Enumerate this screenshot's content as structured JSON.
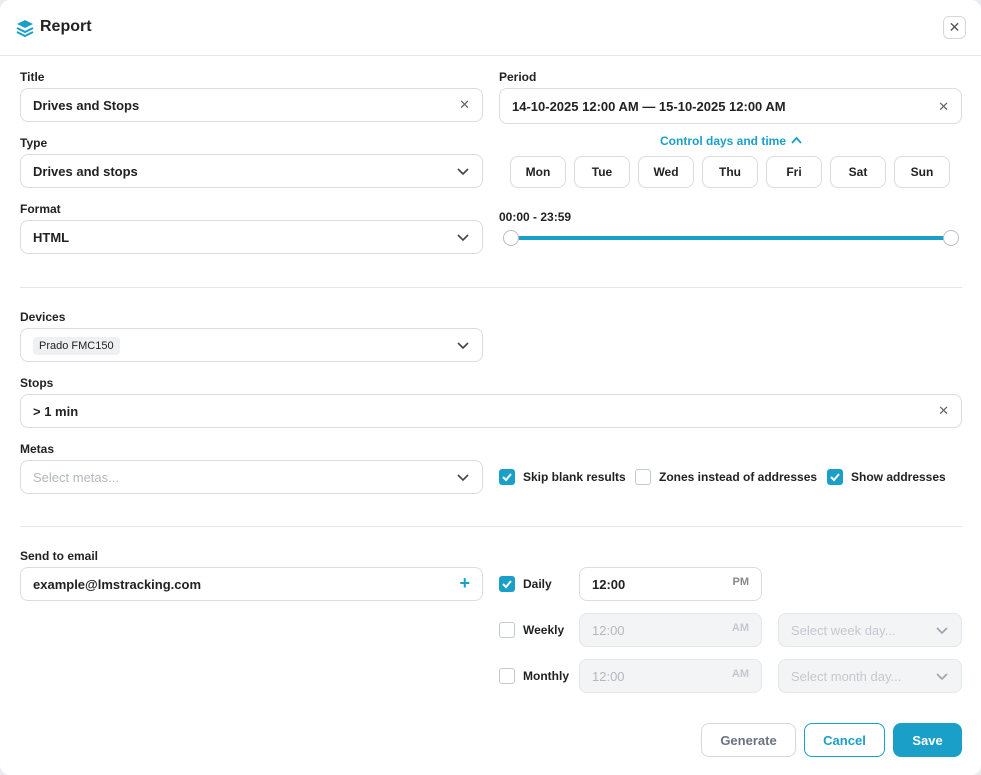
{
  "header": {
    "title": "Report",
    "logo_icon": "layers-icon",
    "close_icon": "close-icon"
  },
  "title_field": {
    "label": "Title",
    "value": "Drives and Stops"
  },
  "period": {
    "label": "Period",
    "value": "14-10-2025 12:00 AM — 15-10-2025 12:00 AM"
  },
  "type_field": {
    "label": "Type",
    "value": "Drives and stops"
  },
  "control_days": {
    "label": "Control days and time",
    "days": [
      "Mon",
      "Tue",
      "Wed",
      "Thu",
      "Fri",
      "Sat",
      "Sun"
    ]
  },
  "format_field": {
    "label": "Format",
    "value": "HTML"
  },
  "time_range": {
    "label": "00:00 - 23:59",
    "start_fraction": 0,
    "end_fraction": 1
  },
  "devices": {
    "label": "Devices",
    "tag": "Prado FMC150"
  },
  "stops": {
    "label": "Stops",
    "value": "> 1 min"
  },
  "metas": {
    "label": "Metas",
    "placeholder": "Select metas..."
  },
  "options": {
    "skip_blank": {
      "label": "Skip blank results",
      "checked": true
    },
    "zones": {
      "label": "Zones instead of addresses",
      "checked": false
    },
    "show_addresses": {
      "label": "Show addresses",
      "checked": true
    }
  },
  "email": {
    "label": "Send to email",
    "value": "example@lmstracking.com"
  },
  "schedule": {
    "daily": {
      "label": "Daily",
      "checked": true,
      "time": "12:00",
      "ampm": "PM"
    },
    "weekly": {
      "label": "Weekly",
      "checked": false,
      "time": "12:00",
      "ampm": "AM",
      "placeholder": "Select week day..."
    },
    "monthly": {
      "label": "Monthly",
      "checked": false,
      "time": "12:00",
      "ampm": "AM",
      "placeholder": "Select month day..."
    }
  },
  "buttons": {
    "generate": "Generate",
    "cancel": "Cancel",
    "save": "Save"
  },
  "colors": {
    "accent": "#1aa0c8"
  }
}
